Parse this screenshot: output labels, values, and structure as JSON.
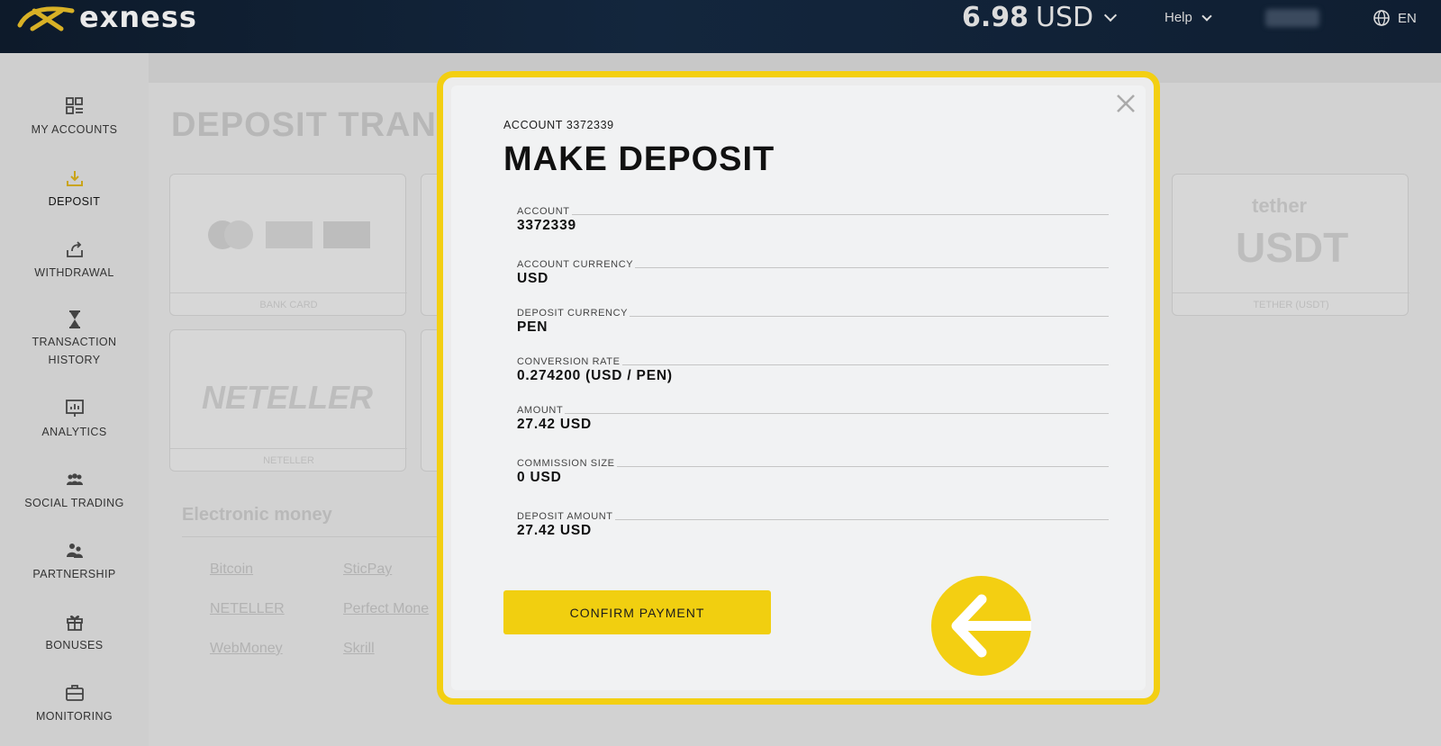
{
  "header": {
    "brand": "exness",
    "balance_amount": "6.98",
    "balance_currency": "USD",
    "help_label": "Help",
    "language": "EN"
  },
  "sidebar": {
    "items": [
      {
        "label": "MY ACCOUNTS",
        "icon": "grid-list-icon"
      },
      {
        "label": "DEPOSIT",
        "icon": "download-tray-icon"
      },
      {
        "label": "WITHDRAWAL",
        "icon": "upload-share-icon"
      },
      {
        "label_line1": "TRANSACTION",
        "label_line2": "HISTORY",
        "icon": "hourglass-icon"
      },
      {
        "label": "ANALYTICS",
        "icon": "chart-monitor-icon"
      },
      {
        "label": "SOCIAL TRADING",
        "icon": "group-people-icon"
      },
      {
        "label": "PARTNERSHIP",
        "icon": "partner-people-icon"
      },
      {
        "label": "BONUSES",
        "icon": "gift-icon"
      },
      {
        "label": "MONITORING",
        "icon": "briefcase-icon"
      }
    ]
  },
  "background": {
    "page_title": "DEPOSIT TRANS",
    "card1_caption": "BANK CARD",
    "card_neteller_caption": "NETELLER",
    "card_tether_brand": "tether",
    "card_tether_big": "USDT",
    "card_tether_caption": "TETHER (USDT)",
    "section_title": "Electronic money",
    "links": [
      "Bitcoin",
      "SticPay",
      "NETELLER",
      "Perfect Mone",
      "WebMoney",
      "Skrill"
    ]
  },
  "modal": {
    "account_label": "ACCOUNT 3372339",
    "title": "MAKE DEPOSIT",
    "rows": [
      {
        "key": "ACCOUNT",
        "value": "3372339"
      },
      {
        "key": "ACCOUNT CURRENCY",
        "value": "USD"
      },
      {
        "key": "DEPOSIT CURRENCY",
        "value": "PEN"
      },
      {
        "key": "CONVERSION RATE",
        "value": "0.274200 (USD / PEN)"
      },
      {
        "key": "AMOUNT",
        "value": "27.42 USD"
      },
      {
        "key": "COMMISSION SIZE",
        "value": "0 USD"
      },
      {
        "key": "DEPOSIT AMOUNT",
        "value": "27.42 USD"
      }
    ],
    "confirm_label": "CONFIRM PAYMENT"
  },
  "colors": {
    "accent": "#f3cf12",
    "header_bg": "#0f1e31"
  }
}
